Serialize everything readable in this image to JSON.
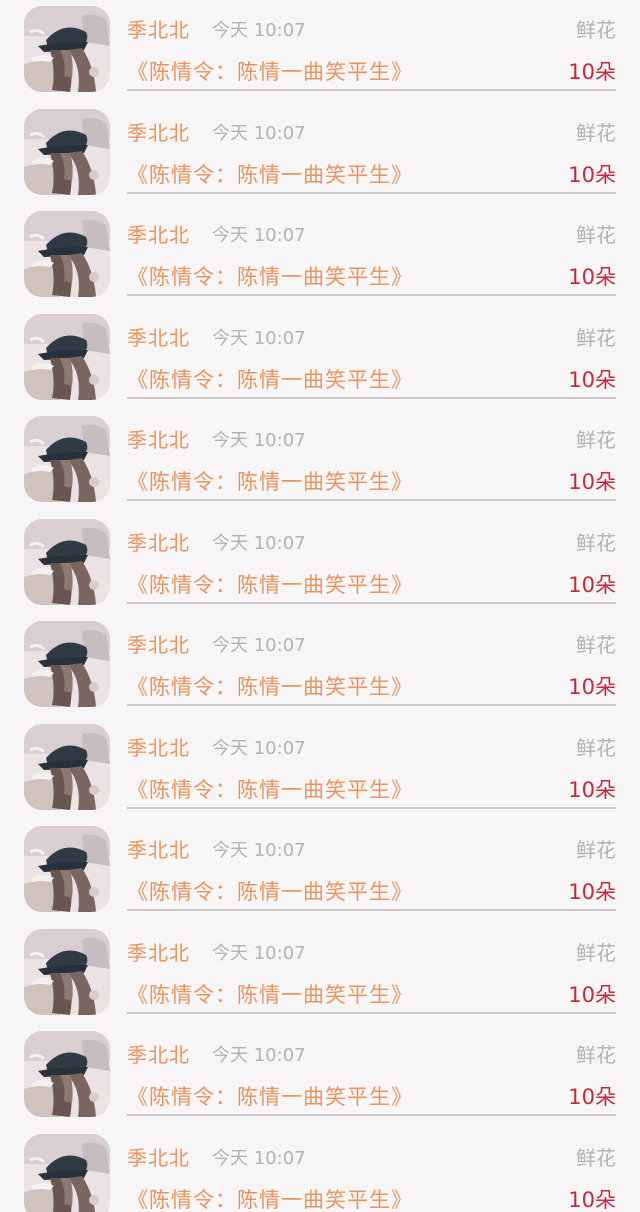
{
  "records": [
    {
      "user": "季北北",
      "time": "今天 10:07",
      "gift": "鲜花",
      "title": "《陈情令：陈情一曲笑平生》",
      "count": "10朵"
    },
    {
      "user": "季北北",
      "time": "今天 10:07",
      "gift": "鲜花",
      "title": "《陈情令：陈情一曲笑平生》",
      "count": "10朵"
    },
    {
      "user": "季北北",
      "time": "今天 10:07",
      "gift": "鲜花",
      "title": "《陈情令：陈情一曲笑平生》",
      "count": "10朵"
    },
    {
      "user": "季北北",
      "time": "今天 10:07",
      "gift": "鲜花",
      "title": "《陈情令：陈情一曲笑平生》",
      "count": "10朵"
    },
    {
      "user": "季北北",
      "time": "今天 10:07",
      "gift": "鲜花",
      "title": "《陈情令：陈情一曲笑平生》",
      "count": "10朵"
    },
    {
      "user": "季北北",
      "time": "今天 10:07",
      "gift": "鲜花",
      "title": "《陈情令：陈情一曲笑平生》",
      "count": "10朵"
    },
    {
      "user": "季北北",
      "time": "今天 10:07",
      "gift": "鲜花",
      "title": "《陈情令：陈情一曲笑平生》",
      "count": "10朵"
    },
    {
      "user": "季北北",
      "time": "今天 10:07",
      "gift": "鲜花",
      "title": "《陈情令：陈情一曲笑平生》",
      "count": "10朵"
    },
    {
      "user": "季北北",
      "time": "今天 10:07",
      "gift": "鲜花",
      "title": "《陈情令：陈情一曲笑平生》",
      "count": "10朵"
    },
    {
      "user": "季北北",
      "time": "今天 10:07",
      "gift": "鲜花",
      "title": "《陈情令：陈情一曲笑平生》",
      "count": "10朵"
    },
    {
      "user": "季北北",
      "time": "今天 10:07",
      "gift": "鲜花",
      "title": "《陈情令：陈情一曲笑平生》",
      "count": "10朵"
    },
    {
      "user": "季北北",
      "time": "今天 10:07",
      "gift": "鲜花",
      "title": "《陈情令：陈情一曲笑平生》",
      "count": "10朵"
    }
  ],
  "colors": {
    "name": "#e8955f",
    "muted": "#b3b3b3",
    "count": "#c8283b",
    "background": "#f7f5f6",
    "divider": "#c9c7c8"
  }
}
